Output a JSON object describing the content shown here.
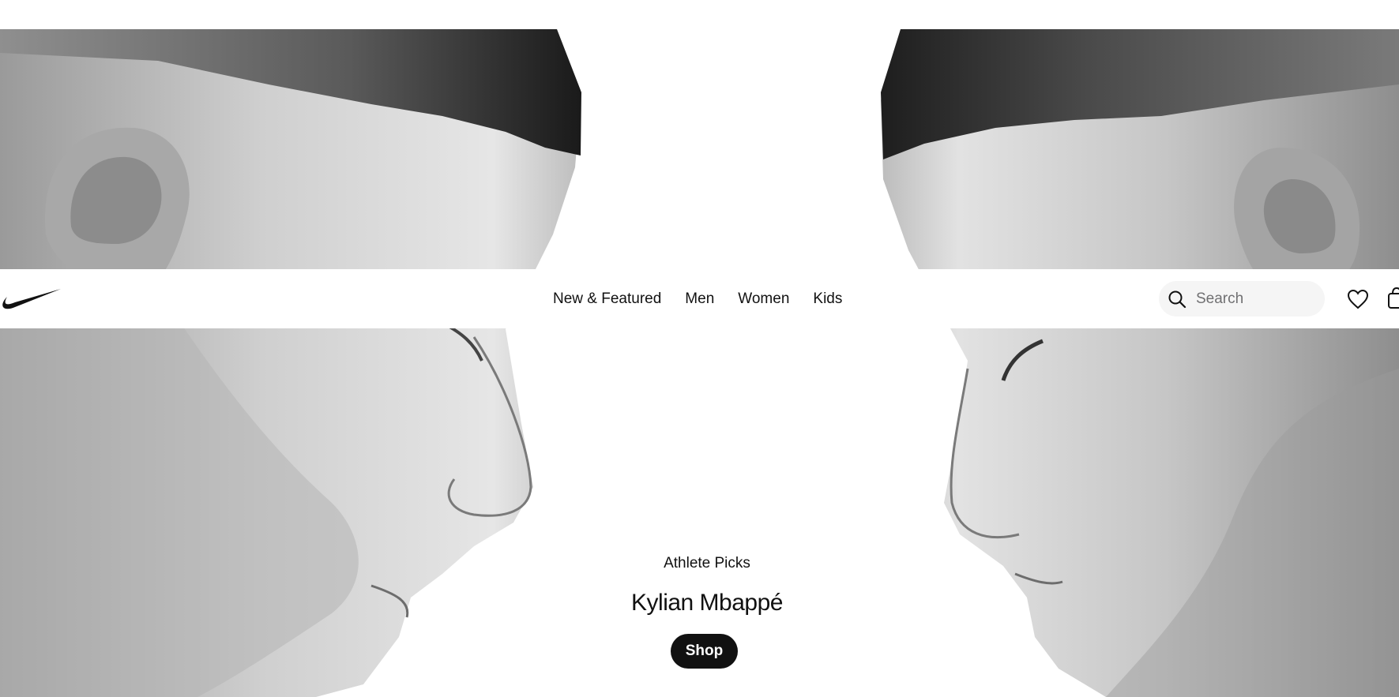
{
  "hero": {
    "image_description_icon": "athlete-profile-faces-photo"
  },
  "navbar": {
    "logo": "nike-swoosh-icon",
    "links": [
      {
        "label": "New & Featured"
      },
      {
        "label": "Men"
      },
      {
        "label": "Women"
      },
      {
        "label": "Kids"
      }
    ],
    "search": {
      "placeholder": "Search",
      "value": ""
    },
    "favorites_icon": "heart-icon",
    "bag_icon": "bag-icon"
  },
  "promo": {
    "eyebrow": "Athlete Picks",
    "title": "Kylian Mbappé",
    "cta_label": "Shop"
  },
  "colors": {
    "text": "#111111",
    "background": "#ffffff",
    "search_bg": "#f5f5f5",
    "button_bg": "#111111",
    "button_text": "#ffffff"
  }
}
